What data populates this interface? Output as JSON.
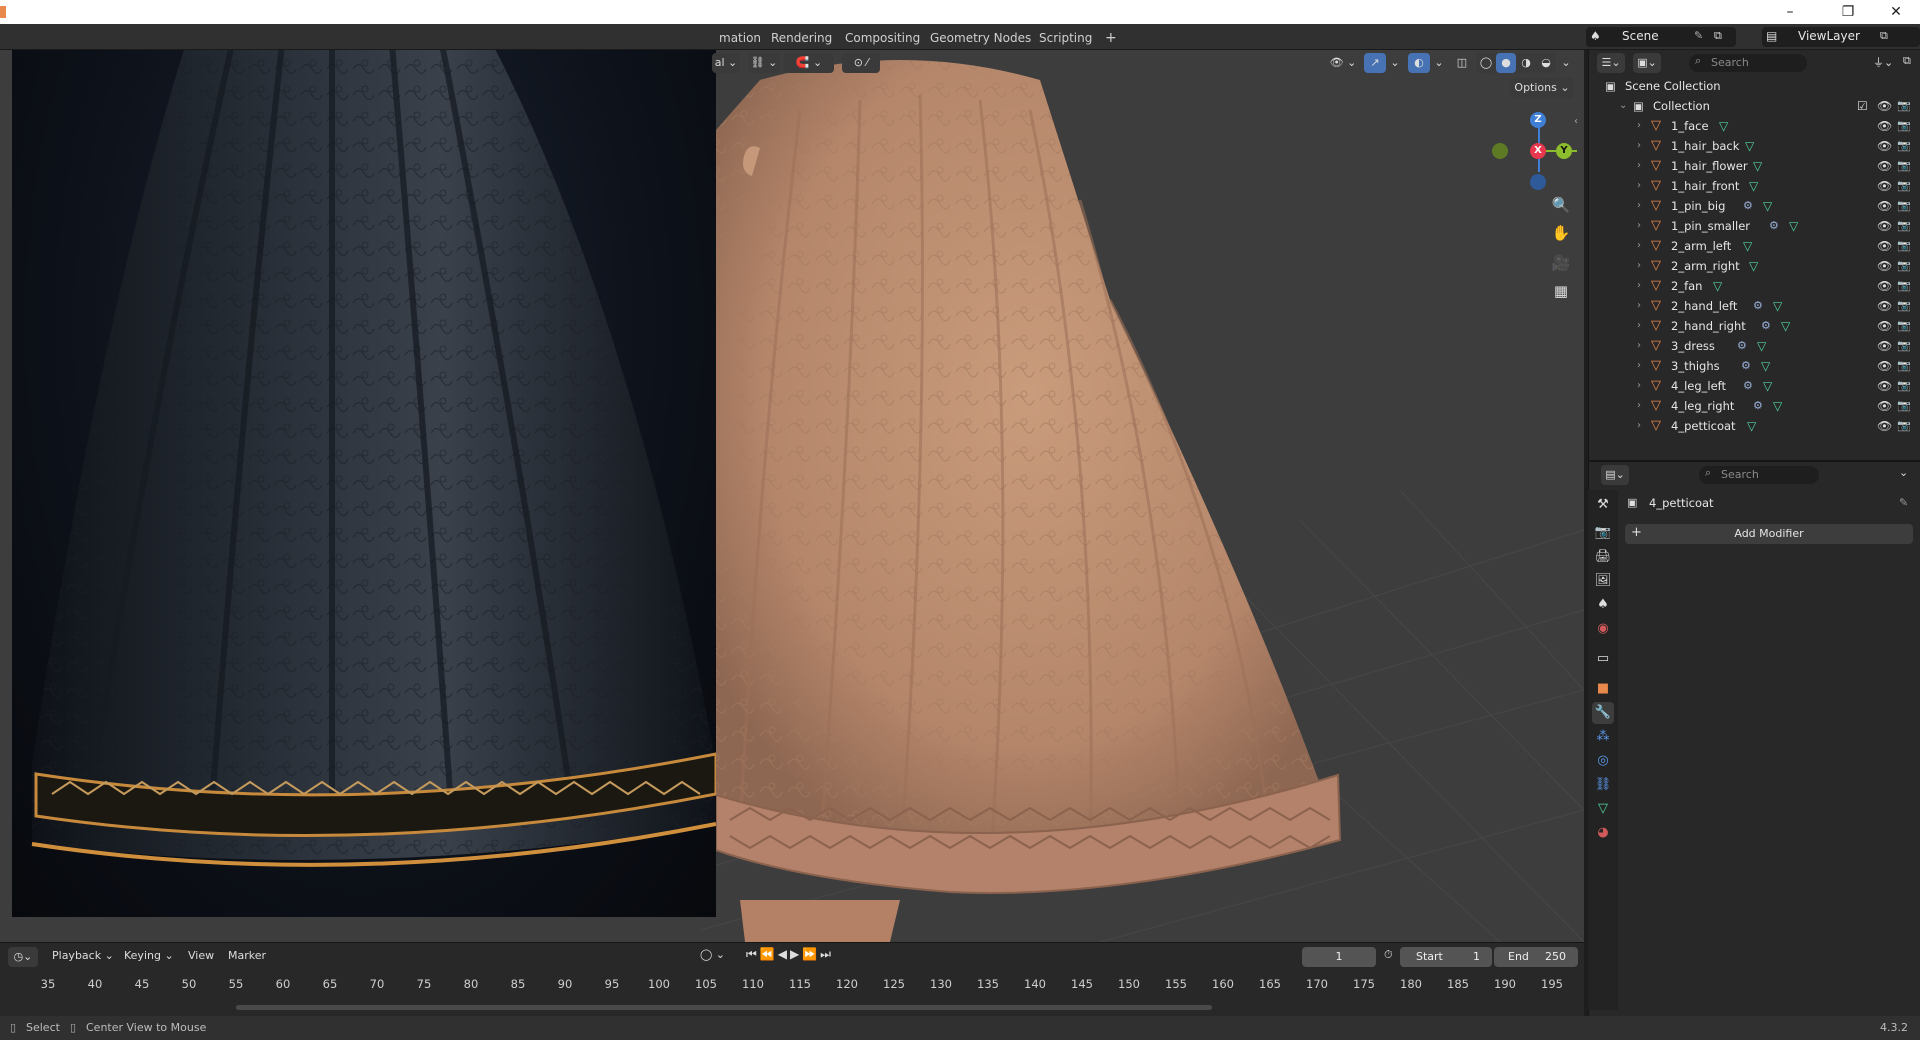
{
  "titlebar": {
    "minimize": "–",
    "restore": "❐",
    "close": "✕"
  },
  "workspace_tabs": [
    "mation",
    "Rendering",
    "Compositing",
    "Geometry Nodes",
    "Scripting",
    "+"
  ],
  "scene": {
    "label": "Scene",
    "view_layer": "ViewLayer"
  },
  "viewport": {
    "options_label": "Options",
    "mode_partial": "al",
    "gizmo": {
      "z": "Z",
      "x": "X",
      "y": "Y"
    }
  },
  "outliner": {
    "search_placeholder": "Search",
    "scene_collection": "Scene Collection",
    "collection": "Collection",
    "objects": [
      {
        "name": "1_face",
        "modifier": false
      },
      {
        "name": "1_hair_back",
        "modifier": false
      },
      {
        "name": "1_hair_flower",
        "modifier": false
      },
      {
        "name": "1_hair_front",
        "modifier": false
      },
      {
        "name": "1_pin_big",
        "modifier": true
      },
      {
        "name": "1_pin_smaller",
        "modifier": true
      },
      {
        "name": "2_arm_left",
        "modifier": false
      },
      {
        "name": "2_arm_right",
        "modifier": false
      },
      {
        "name": "2_fan",
        "modifier": false
      },
      {
        "name": "2_hand_left",
        "modifier": true
      },
      {
        "name": "2_hand_right",
        "modifier": true
      },
      {
        "name": "3_dress",
        "modifier": true
      },
      {
        "name": "3_thighs",
        "modifier": true
      },
      {
        "name": "4_leg_left",
        "modifier": true
      },
      {
        "name": "4_leg_right",
        "modifier": true
      },
      {
        "name": "4_petticoat",
        "modifier": false
      }
    ]
  },
  "properties": {
    "search_placeholder": "Search",
    "object_name": "4_petticoat",
    "add_modifier": "Add Modifier"
  },
  "timeline": {
    "menus": [
      "Playback",
      "Keying",
      "View",
      "Marker"
    ],
    "current_frame": "1",
    "start_label": "Start",
    "start_value": "1",
    "end_label": "End",
    "end_value": "250",
    "ticks": [
      "35",
      "40",
      "45",
      "50",
      "55",
      "60",
      "65",
      "70",
      "75",
      "80",
      "85",
      "90",
      "95",
      "100",
      "105",
      "110",
      "115",
      "120",
      "125",
      "130",
      "135",
      "140",
      "145",
      "150",
      "155",
      "160",
      "165",
      "170",
      "175",
      "180",
      "185",
      "190",
      "195"
    ]
  },
  "status": {
    "select": "Select",
    "center_view": "Center View to Mouse",
    "version": "4.3.2"
  },
  "colors": {
    "accent": "#4772b3",
    "object_orange": "#e7894a",
    "mesh_green": "#52d69e",
    "viewport_bg": "#3d3d3d"
  }
}
